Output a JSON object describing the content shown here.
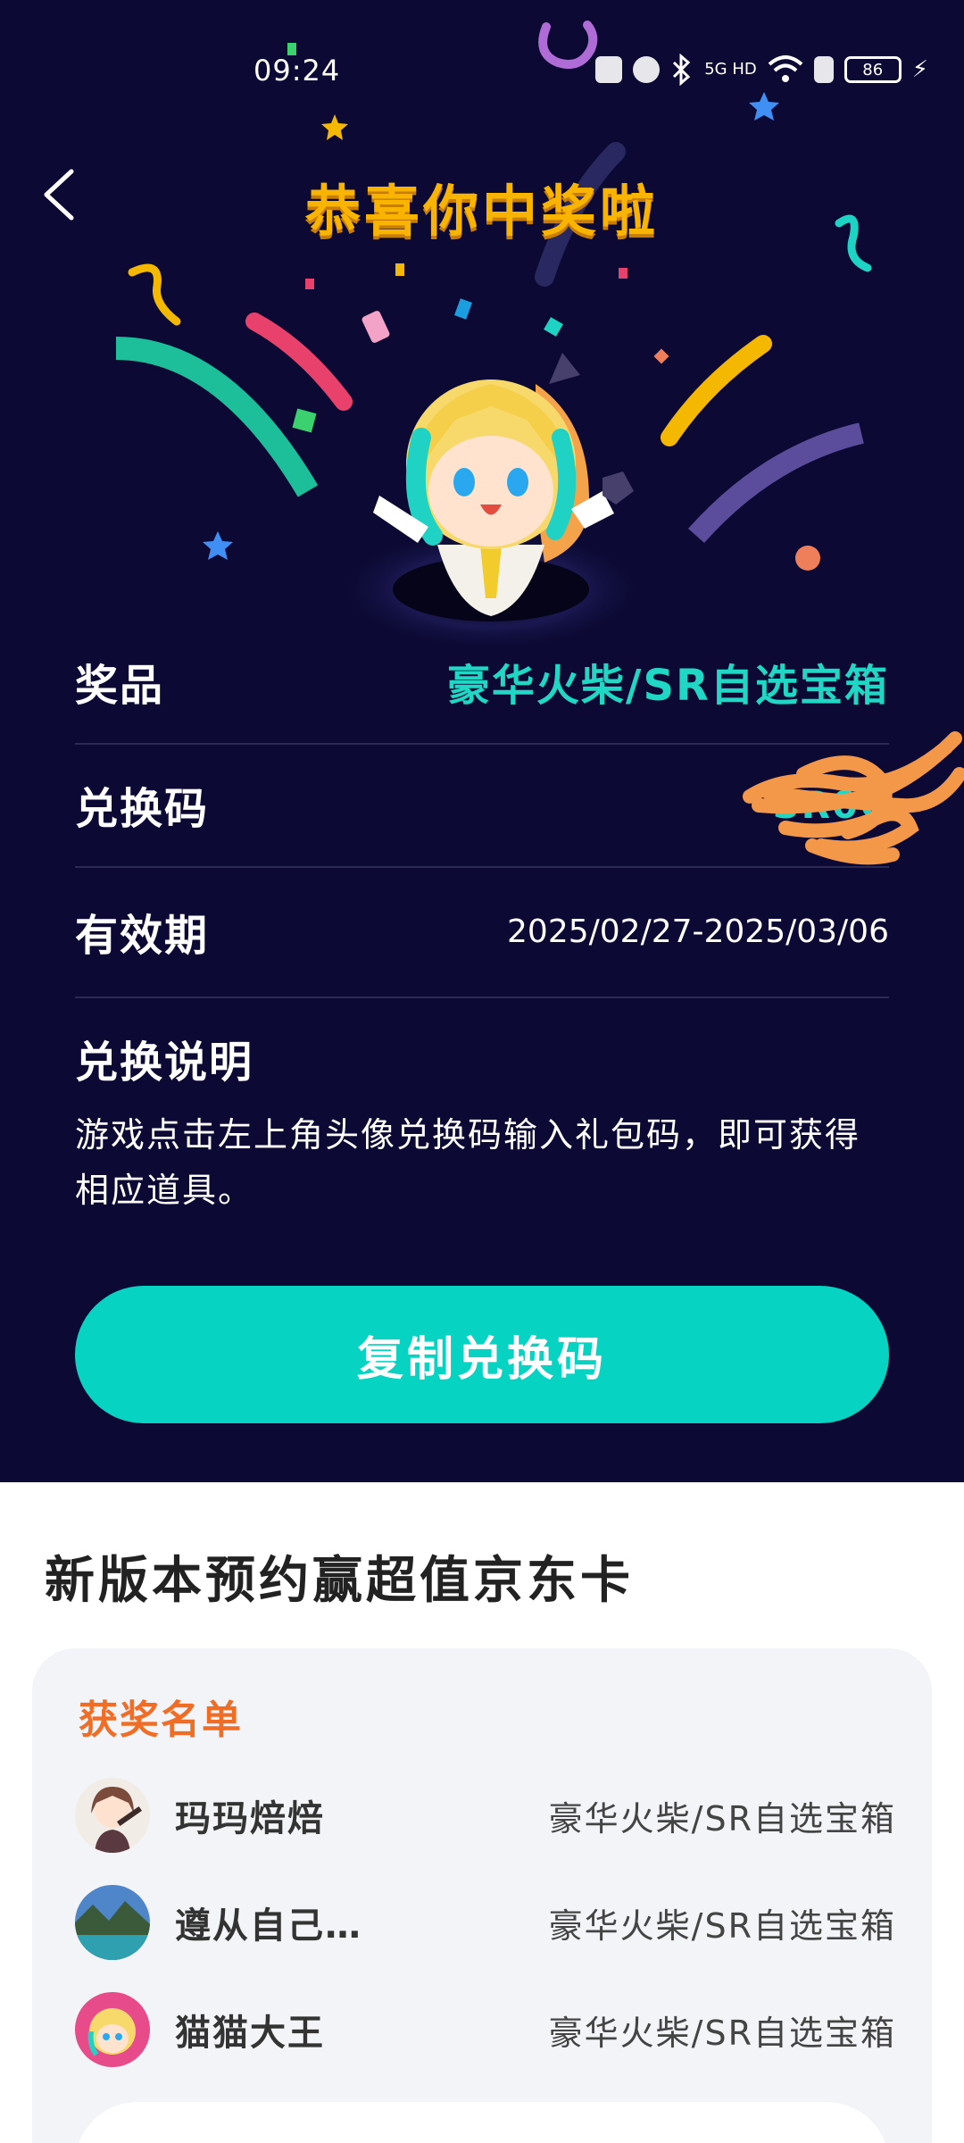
{
  "status_bar": {
    "time": "09:24",
    "network": "5G HD",
    "battery": "86"
  },
  "header": {
    "title": "恭喜你中奖啦"
  },
  "reward": {
    "prize_label": "奖品",
    "prize_value": "豪华火柴/SR自选宝箱",
    "code_label": "兑换码",
    "code_value": "SR0C",
    "validity_label": "有效期",
    "validity_value": "2025/02/27-2025/03/06",
    "desc_title": "兑换说明",
    "desc_text": "游戏点击左上角头像兑换码输入礼包码，即可获得相应道具。",
    "copy_button": "复制兑换码"
  },
  "promo": {
    "title": "新版本预约赢超值京东卡",
    "winners_title": "获奖名单",
    "winners": [
      {
        "name": "玛玛焙焙",
        "prize": "豪华火柴/SR自选宝箱",
        "avatar": "anime-girl-avatar"
      },
      {
        "name": "遵从自己…",
        "prize": "豪华火柴/SR自选宝箱",
        "avatar": "landscape-avatar"
      },
      {
        "name": "猫猫大王",
        "prize": "豪华火柴/SR自选宝箱",
        "avatar": "mascot-avatar"
      }
    ]
  },
  "colors": {
    "hero_bg": "#0c0a34",
    "accent": "#06d3c2",
    "title_gold": "#f9b400",
    "winners_orange": "#f06d26"
  }
}
